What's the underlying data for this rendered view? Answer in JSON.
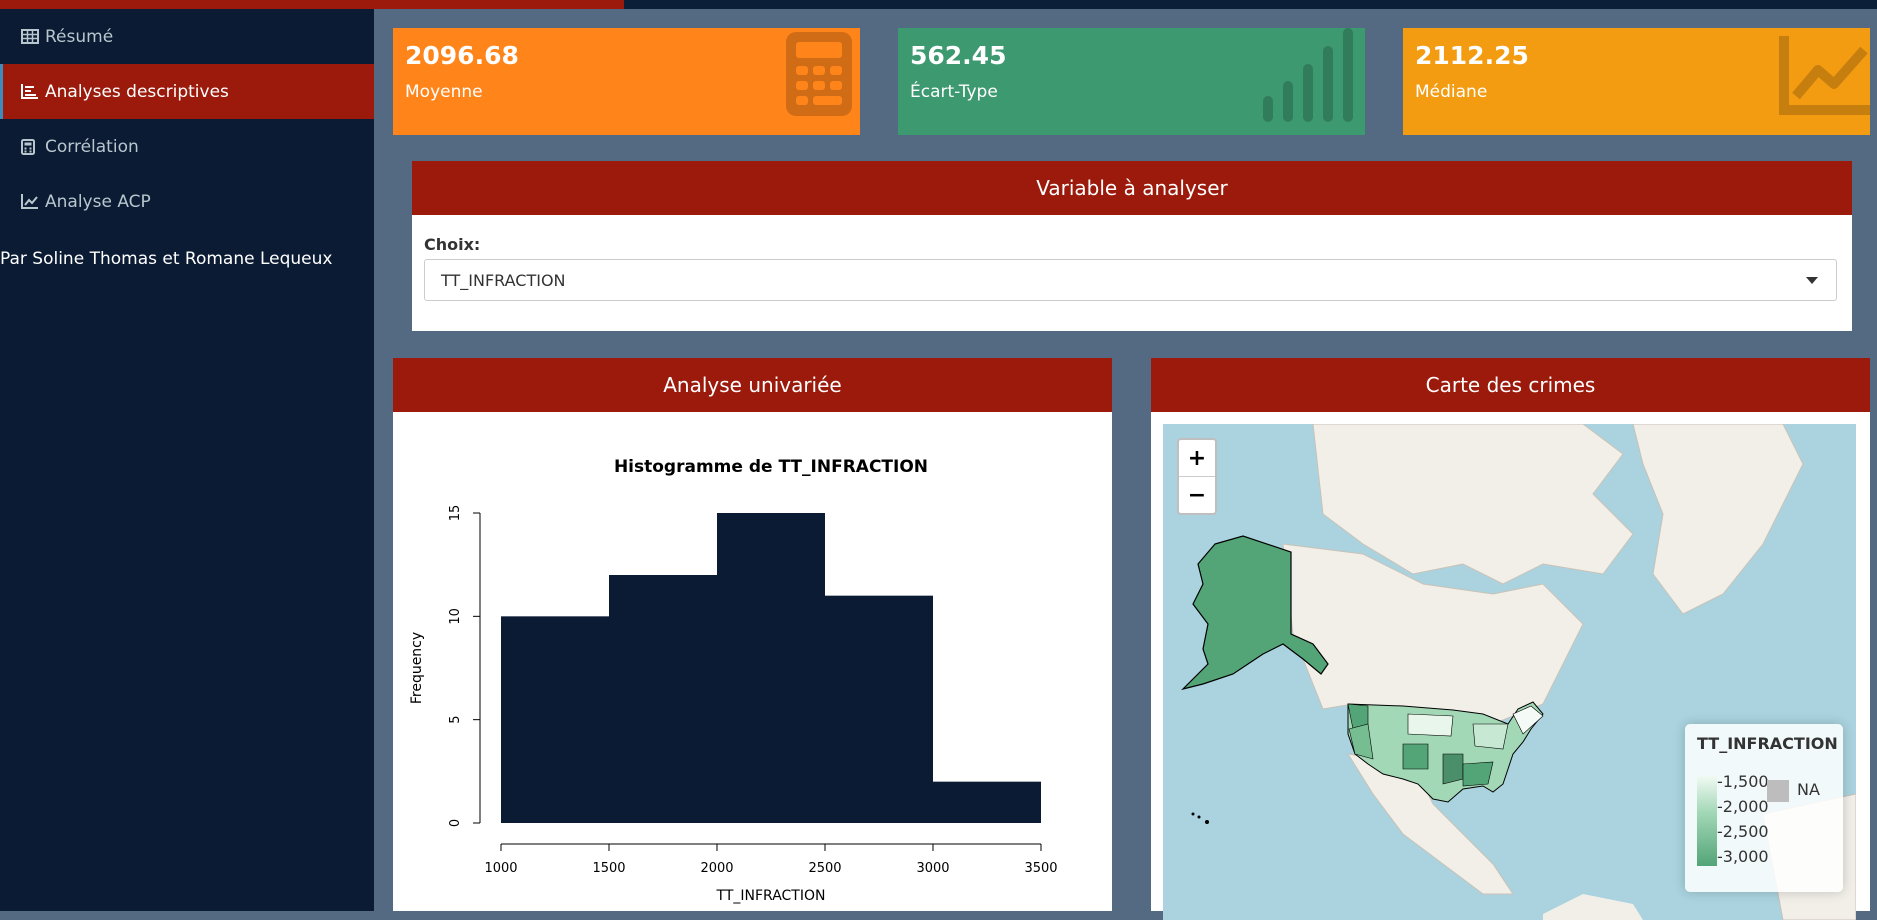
{
  "sidebar": {
    "items": [
      {
        "label": "Résumé",
        "icon": "table-icon"
      },
      {
        "label": "Analyses descriptives",
        "icon": "bar-chart-icon",
        "active": true
      },
      {
        "label": "Corrélation",
        "icon": "calculator-icon"
      },
      {
        "label": "Analyse ACP",
        "icon": "line-chart-icon"
      }
    ],
    "footer": "Par Soline Thomas et Romane Lequeux"
  },
  "value_boxes": [
    {
      "value": "2096.68",
      "label": "Moyenne",
      "color": "#ff851b",
      "icon": "calculator-icon"
    },
    {
      "value": "562.45",
      "label": "Écart-Type",
      "color": "#3d9970",
      "icon": "signal-icon"
    },
    {
      "value": "2112.25",
      "label": "Médiane",
      "color": "#f39c12",
      "icon": "line-chart-icon"
    }
  ],
  "variable_box": {
    "title": "Variable à analyser",
    "choice_label": "Choix:",
    "selected": "TT_INFRACTION"
  },
  "univariate_box": {
    "title": "Analyse univariée"
  },
  "map_box": {
    "title": "Carte des crimes",
    "zoom_in": "+",
    "zoom_out": "−",
    "legend_title": "TT_INFRACTION",
    "legend_ticks": [
      "-1,500",
      "-2,000",
      "-2,500",
      "-3,000"
    ],
    "legend_na": "NA"
  },
  "colors": {
    "header": "#9b1a0c",
    "sidebar": "#0b1b33",
    "bars": "#0b1b33"
  },
  "chart_data": {
    "type": "bar",
    "title": "Histogramme de TT_INFRACTION",
    "xlabel": "TT_INFRACTION",
    "ylabel": "Frequency",
    "bins": [
      [
        1000,
        1500
      ],
      [
        1500,
        2000
      ],
      [
        2000,
        2500
      ],
      [
        2500,
        3000
      ],
      [
        3000,
        3500
      ]
    ],
    "values": [
      10,
      12,
      15,
      11,
      2
    ],
    "xticks": [
      1000,
      1500,
      2000,
      2500,
      3000,
      3500
    ],
    "yticks": [
      0,
      5,
      10,
      15
    ],
    "xlim": [
      1000,
      3500
    ],
    "ylim": [
      0,
      15
    ]
  }
}
